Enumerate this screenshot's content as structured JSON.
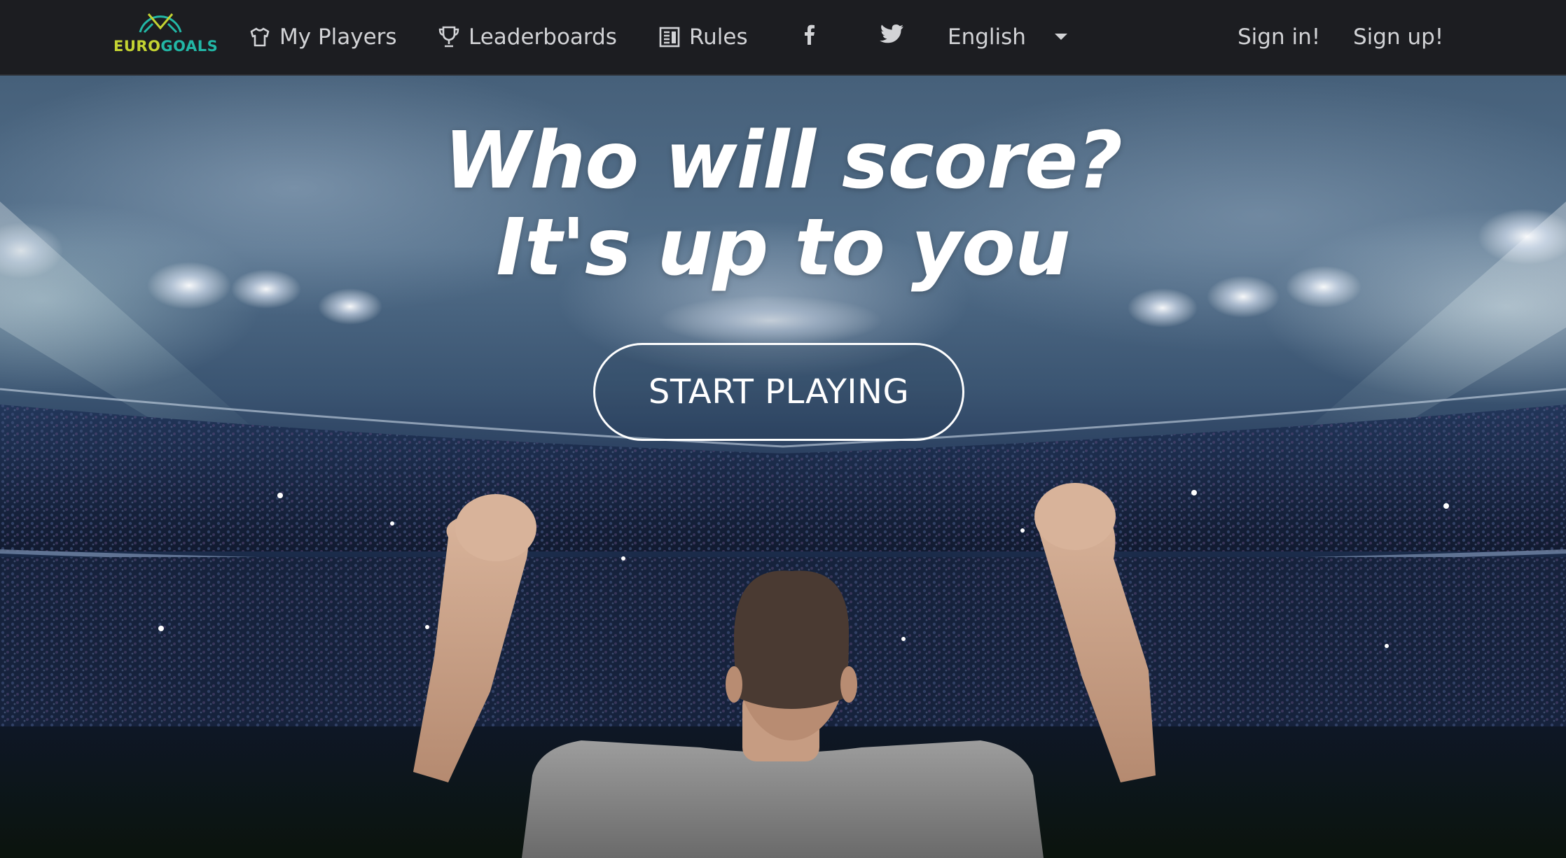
{
  "logo": {
    "text_euro": "EURO",
    "text_goals": "GOALS",
    "colors": {
      "euro": "#c4d332",
      "goals": "#22b7a6"
    }
  },
  "nav": {
    "my_players": "My Players",
    "leaderboards": "Leaderboards",
    "rules": "Rules",
    "facebook_icon": "facebook-icon",
    "twitter_icon": "twitter-icon",
    "language": "English",
    "sign_in": "Sign in!",
    "sign_up": "Sign up!"
  },
  "hero": {
    "headline_line1": "Who will score?",
    "headline_line2": "It's up to you",
    "cta_label": "START PLAYING"
  },
  "colors": {
    "navbar_bg": "#1c1d21",
    "nav_text": "#d2d3d6",
    "hero_text": "#ffffff"
  }
}
